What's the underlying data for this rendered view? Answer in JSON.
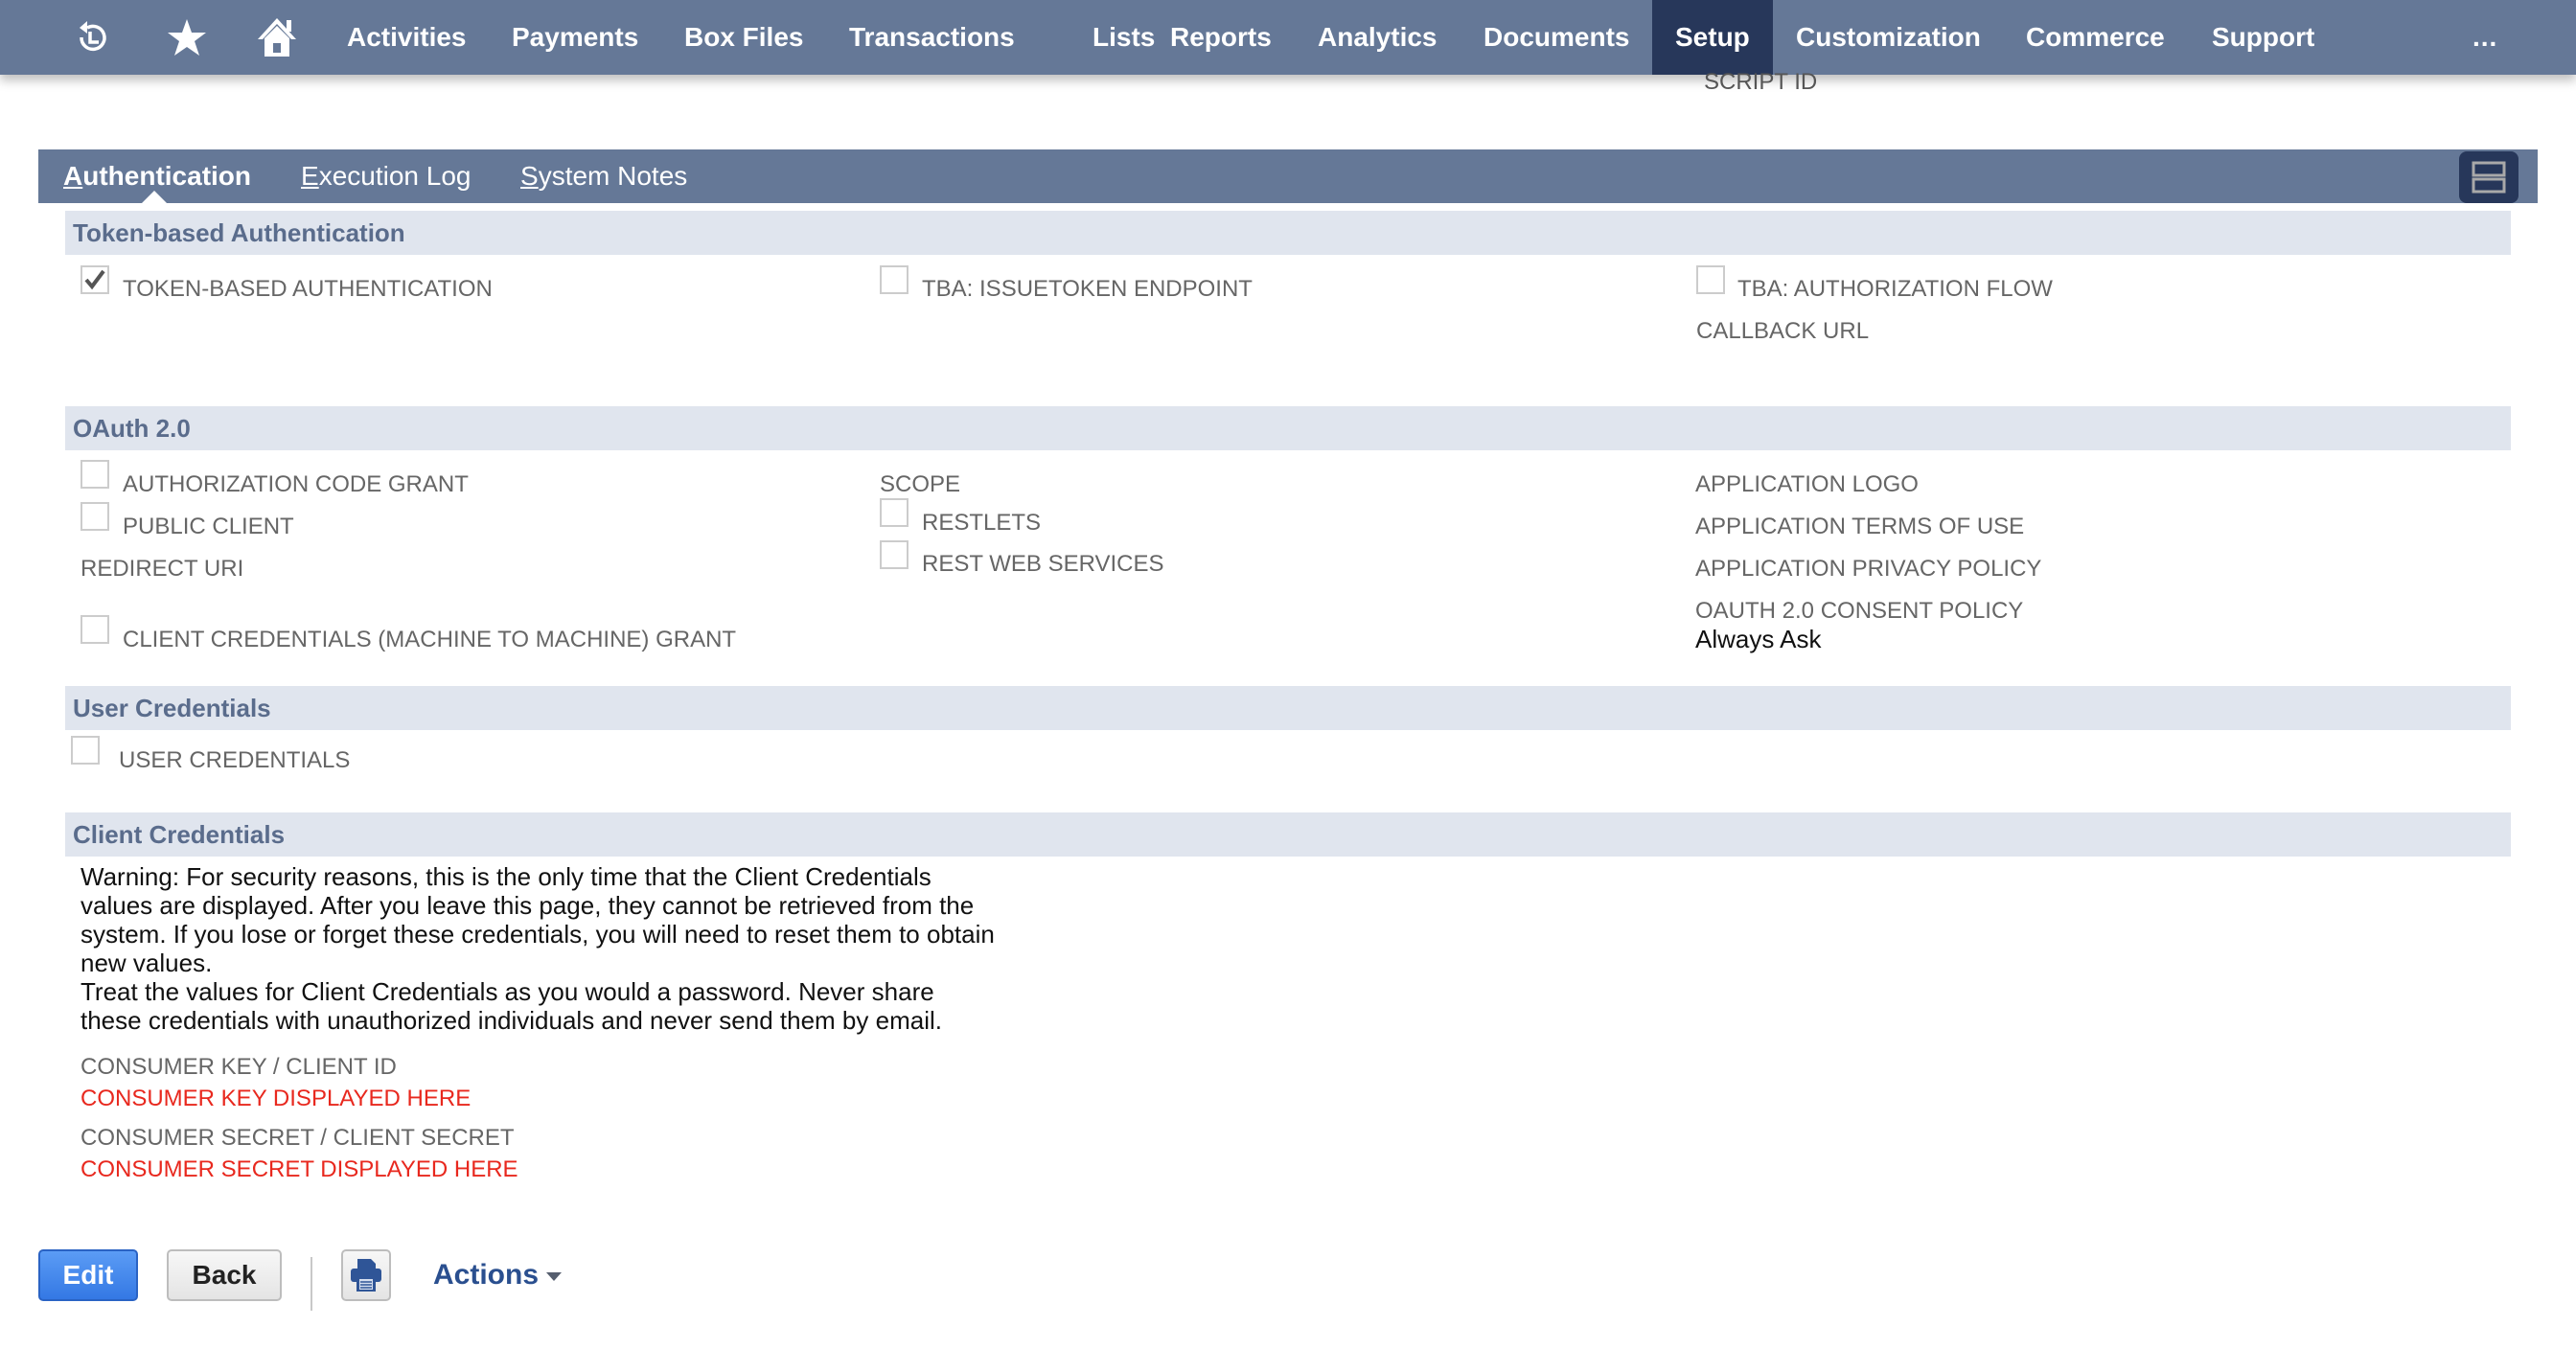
{
  "navbar": {
    "icons": [
      "recent-records-icon",
      "star-icon",
      "home-icon"
    ],
    "items": [
      {
        "label": "Activities"
      },
      {
        "label": "Payments"
      },
      {
        "label": "Box Files"
      },
      {
        "label": "Transactions"
      },
      {
        "label": "Lists"
      },
      {
        "label": "Reports"
      },
      {
        "label": "Analytics"
      },
      {
        "label": "Documents"
      },
      {
        "label": "Setup",
        "active": true
      },
      {
        "label": "Customization"
      },
      {
        "label": "Commerce"
      },
      {
        "label": "Support"
      }
    ],
    "more": "..."
  },
  "header": {
    "script_id_label": "SCRIPT ID"
  },
  "tabs": [
    {
      "first": "A",
      "rest": "uthentication",
      "active": true
    },
    {
      "first": "E",
      "rest": "xecution Log"
    },
    {
      "first": "S",
      "rest": "ystem Notes"
    }
  ],
  "sections": {
    "tba": {
      "title": "Token-based Authentication",
      "token_based_auth": {
        "label": "TOKEN-BASED AUTHENTICATION",
        "checked": true
      },
      "issuetoken_endpoint": {
        "label": "TBA: ISSUETOKEN ENDPOINT",
        "checked": false
      },
      "authorization_flow": {
        "label": "TBA: AUTHORIZATION FLOW",
        "checked": false
      },
      "callback_url_label": "CALLBACK URL"
    },
    "oauth": {
      "title": "OAuth 2.0",
      "authorization_code_grant": {
        "label": "AUTHORIZATION CODE GRANT",
        "checked": false
      },
      "public_client": {
        "label": "PUBLIC CLIENT",
        "checked": false
      },
      "redirect_uri_label": "REDIRECT URI",
      "client_credentials_grant": {
        "label": "CLIENT CREDENTIALS (MACHINE TO MACHINE) GRANT",
        "checked": false
      },
      "scope_label": "SCOPE",
      "restlets": {
        "label": "RESTLETS",
        "checked": false
      },
      "rest_web_services": {
        "label": "REST WEB SERVICES",
        "checked": false
      },
      "application_logo_label": "APPLICATION LOGO",
      "terms_of_use_label": "APPLICATION TERMS OF USE",
      "privacy_policy_label": "APPLICATION PRIVACY POLICY",
      "consent_policy_label": "OAUTH 2.0 CONSENT POLICY",
      "consent_policy_value": "Always Ask"
    },
    "user_credentials": {
      "title": "User Credentials",
      "user_credentials": {
        "label": "USER CREDENTIALS",
        "checked": false
      }
    },
    "client_credentials": {
      "title": "Client Credentials",
      "warning_p1": "Warning: For security reasons, this is the only time that the Client Credentials values are displayed. After you leave this page, they cannot be retrieved from the system. If you lose or forget these credentials, you will need to reset them to obtain new values.",
      "warning_p2": "Treat the values for Client Credentials as you would a password. Never share these credentials with unauthorized individuals and never send them by email.",
      "consumer_key_label": "CONSUMER KEY / CLIENT ID",
      "consumer_key_value": "CONSUMER KEY DISPLAYED HERE",
      "consumer_secret_label": "CONSUMER SECRET / CLIENT SECRET",
      "consumer_secret_value": "CONSUMER SECRET DISPLAYED HERE"
    }
  },
  "footer": {
    "edit_label": "Edit",
    "back_label": "Back",
    "print_icon": "print-icon",
    "actions_label": "Actions"
  },
  "colors": {
    "navbar": "#657897",
    "navbar_active": "#27375a",
    "section_header_bg": "#e0e5ee",
    "section_header_text": "#5a6c8c",
    "credential_value": "#e8281e",
    "edit_button": "#3478e4",
    "actions_link": "#2a4f8f"
  }
}
